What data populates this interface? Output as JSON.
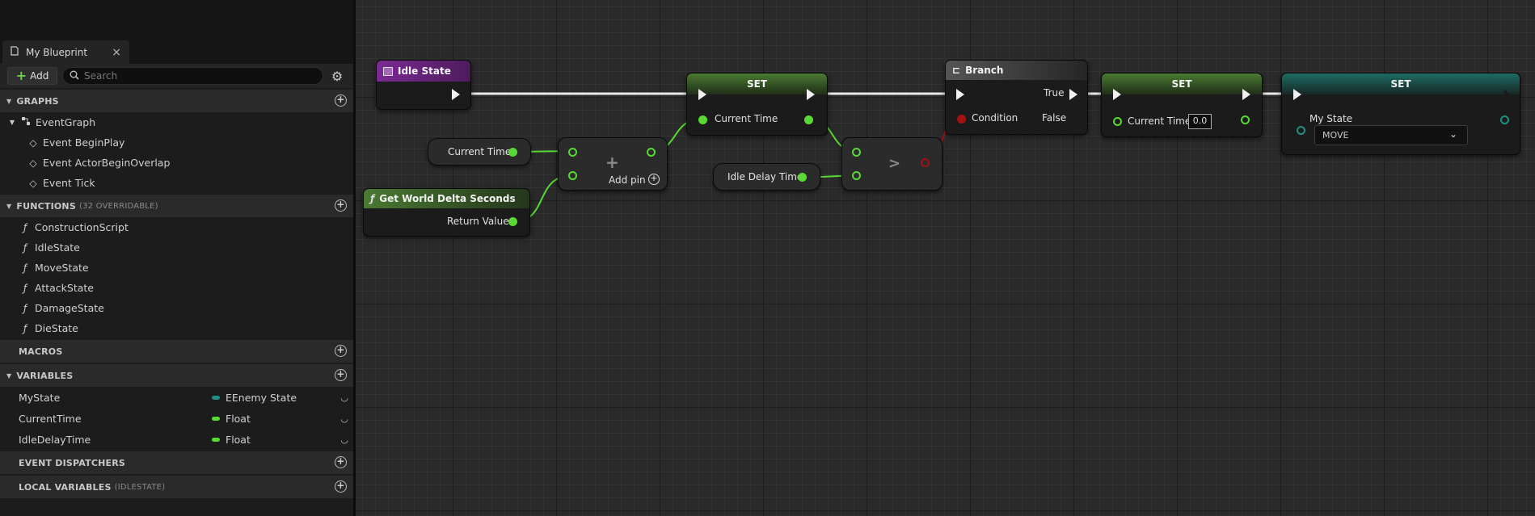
{
  "panel": {
    "tab_title": "My Blueprint",
    "tab_close": "×",
    "add_label": "Add",
    "search_placeholder": "Search",
    "sections": {
      "graphs": "GRAPHS",
      "functions": "FUNCTIONS",
      "functions_sub": "(32 OVERRIDABLE)",
      "macros": "MACROS",
      "variables": "VARIABLES",
      "dispatchers": "EVENT DISPATCHERS",
      "local_vars": "LOCAL VARIABLES",
      "local_vars_sub": "(IDLESTATE)"
    },
    "graphs": {
      "event_graph": "EventGraph",
      "events": [
        "Event BeginPlay",
        "Event ActorBeginOverlap",
        "Event Tick"
      ]
    },
    "functions": [
      "ConstructionScript",
      "IdleState",
      "MoveState",
      "AttackState",
      "DamageState",
      "DieState"
    ],
    "variables": [
      {
        "name": "MyState",
        "type": "EEnemy State",
        "color": "#1e8f84"
      },
      {
        "name": "CurrentTime",
        "type": "Float",
        "color": "#59d934"
      },
      {
        "name": "IdleDelayTime",
        "type": "Float",
        "color": "#59d934"
      }
    ]
  },
  "graph": {
    "colors": {
      "float_pin": "#59d934",
      "enum_pin": "#1e8f84",
      "bool_pin": "#a31212",
      "function_header": "#7b2a92",
      "set_header": "#4a7a32",
      "branch_header": "#3c3c3c"
    },
    "idle_state": {
      "title": "Idle State"
    },
    "get_current_time": {
      "label": "Current Time"
    },
    "get_world_delta": {
      "title": "Get World Delta Seconds",
      "return_label": "Return Value"
    },
    "add_node": {
      "symbol": "+",
      "add_pin_label": "Add pin"
    },
    "set1": {
      "title": "SET",
      "pin_label": "Current Time"
    },
    "idle_delay": {
      "label": "Idle Delay Time"
    },
    "compare": {
      "symbol": ">"
    },
    "branch": {
      "title": "Branch",
      "condition_label": "Condition",
      "true_label": "True",
      "false_label": "False"
    },
    "set2": {
      "title": "SET",
      "pin_label": "Current Time",
      "value": "0.0"
    },
    "set3": {
      "title": "SET",
      "pin_label": "My State",
      "selected": "MOVE"
    }
  }
}
